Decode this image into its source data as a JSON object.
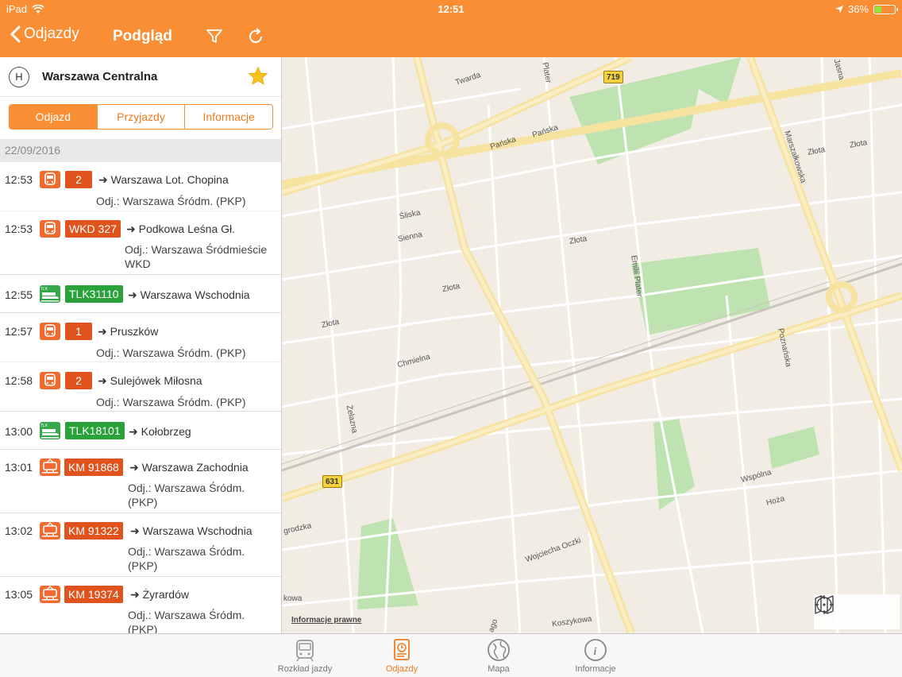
{
  "status_bar": {
    "device": "iPad",
    "time": "12:51",
    "battery": "36%",
    "battery_level": 0.36
  },
  "nav": {
    "back_label": "Odjazdy",
    "title": "Podgląd"
  },
  "station": {
    "name": "Warszawa Centralna",
    "icon_letter": "H"
  },
  "segments": [
    {
      "label": "Odjazd",
      "active": true
    },
    {
      "label": "Przyjazdy",
      "active": false
    },
    {
      "label": "Informacje",
      "active": false
    }
  ],
  "date": "22/09/2016",
  "departures": [
    {
      "time": "12:53",
      "kind": "skm",
      "badge": "2",
      "dest": "➜ Warszawa Lot. Chopina",
      "via": "Odj.: Warszawa Śródm. (PKP)"
    },
    {
      "time": "12:53",
      "kind": "skm",
      "badge": "WKD 327",
      "dest": "➜ Podkowa Leśna Gł.",
      "via": "Odj.: Warszawa Śródmieście WKD"
    },
    {
      "time": "12:55",
      "kind": "tlk",
      "badge": "TLK31110",
      "dest": "➜ Warszawa Wschodnia",
      "via": ""
    },
    {
      "time": "12:57",
      "kind": "skm",
      "badge": "1",
      "dest": "➜ Pruszków",
      "via": "Odj.: Warszawa Śródm. (PKP)"
    },
    {
      "time": "12:58",
      "kind": "skm",
      "badge": "2",
      "dest": "➜ Sulejówek Miłosna",
      "via": "Odj.: Warszawa Śródm. (PKP)"
    },
    {
      "time": "13:00",
      "kind": "tlk",
      "badge": "TLK18101",
      "dest": "➜ Kołobrzeg",
      "via": ""
    },
    {
      "time": "13:01",
      "kind": "km",
      "badge": "KM 91868",
      "dest": "➜ Warszawa Zachodnia",
      "via": "Odj.: Warszawa Śródm. (PKP)"
    },
    {
      "time": "13:02",
      "kind": "km",
      "badge": "KM 91322",
      "dest": "➜ Warszawa Wschodnia",
      "via": "Odj.: Warszawa Śródm. (PKP)"
    },
    {
      "time": "13:05",
      "kind": "km",
      "badge": "KM 19374",
      "dest": "➜ Żyrardów",
      "via": "Odj.: Warszawa Śródm. (PKP)"
    }
  ],
  "map": {
    "legal_link": "Informacje prawne",
    "streets": [
      "Twarda",
      "Pańska",
      "Pańska",
      "Śliska",
      "Sienna",
      "Złota",
      "Złota",
      "Złota",
      "Chmielna",
      "Żelazna",
      "Emilii Plater",
      "Marszałkowska",
      "Złota",
      "Złota",
      "Poznańska",
      "Wspólna",
      "Hoża",
      "Wojciecha Oczki",
      "Koszykowa",
      "grodzka",
      "kowa",
      "ago",
      "Jasna",
      "Plater"
    ],
    "route_shields": [
      "719",
      "631"
    ]
  },
  "tabs": [
    {
      "label": "Rozkład jazdy",
      "icon": "train-schedule-icon",
      "active": false
    },
    {
      "label": "Odjazdy",
      "icon": "clock-sheet-icon",
      "active": true
    },
    {
      "label": "Mapa",
      "icon": "globe-icon",
      "active": false
    },
    {
      "label": "Informacje",
      "icon": "info-icon",
      "active": false
    }
  ],
  "colors": {
    "accent": "#f98e35",
    "badge_orange": "#e0531c",
    "badge_green": "#2aa23a"
  }
}
